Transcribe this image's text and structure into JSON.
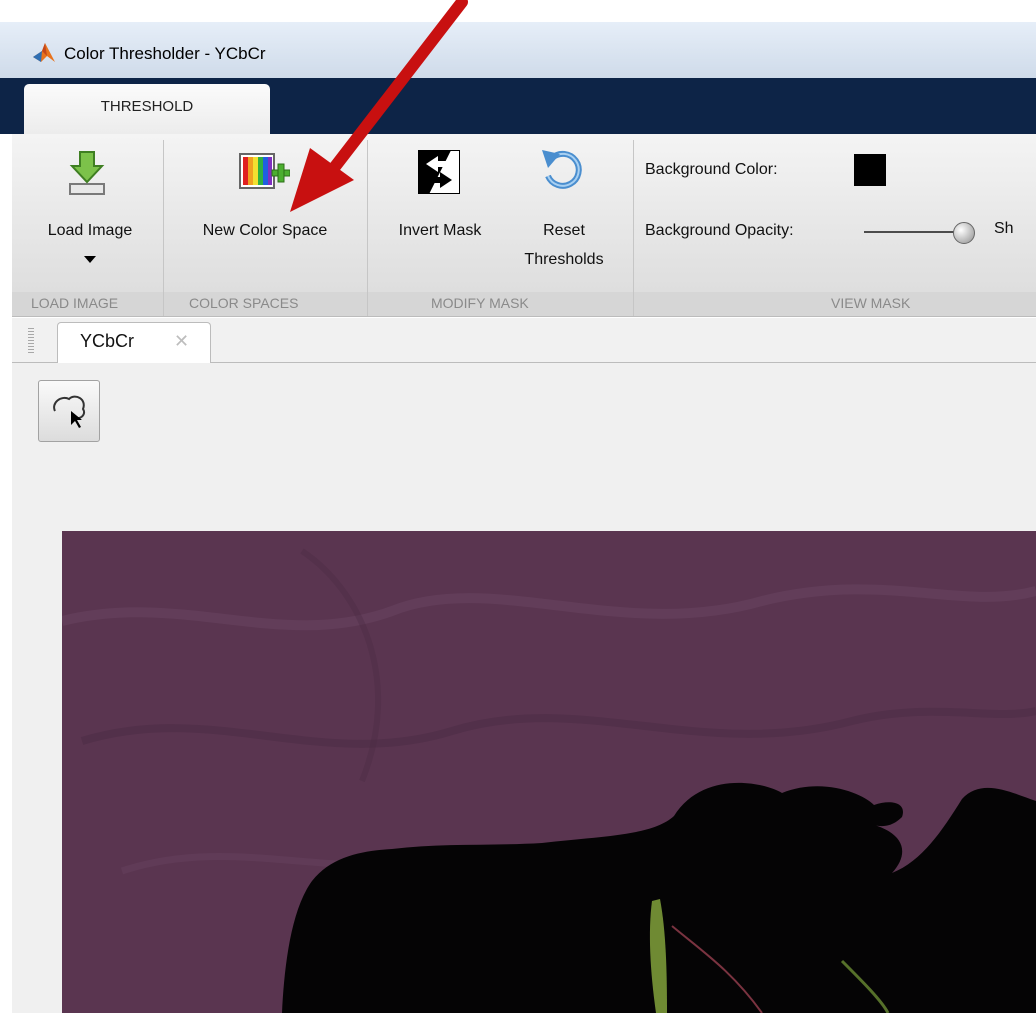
{
  "window": {
    "title": "Color Thresholder - YCbCr"
  },
  "ribbon": {
    "active_tab": "THRESHOLD",
    "buttons": {
      "load_image": "Load Image",
      "new_color_space": "New Color Space",
      "invert_mask": "Invert Mask",
      "reset_thresholds_line1": "Reset",
      "reset_thresholds_line2": "Thresholds"
    },
    "groups": {
      "load_image": "LOAD IMAGE",
      "color_spaces": "COLOR SPACES",
      "modify_mask": "MODIFY MASK",
      "view_mask": "VIEW MASK"
    },
    "view_mask": {
      "background_color_label": "Background Color:",
      "background_color": "#000000",
      "background_opacity_label": "Background Opacity:",
      "background_opacity": 1.0,
      "truncated_text": "Sh"
    }
  },
  "document": {
    "tab_label": "YCbCr",
    "close_glyph": "✕"
  },
  "icons": {
    "app": "matlab-icon",
    "load": "download-arrow-icon",
    "new_color_space": "color-bars-plus-icon",
    "invert": "invert-arrows-icon",
    "reset": "undo-arrow-icon",
    "lasso": "freehand-roi-icon"
  },
  "colors": {
    "annotation_arrow": "#c81010",
    "ribbon_band": "#0d2447",
    "image_background": "#5a3550"
  }
}
